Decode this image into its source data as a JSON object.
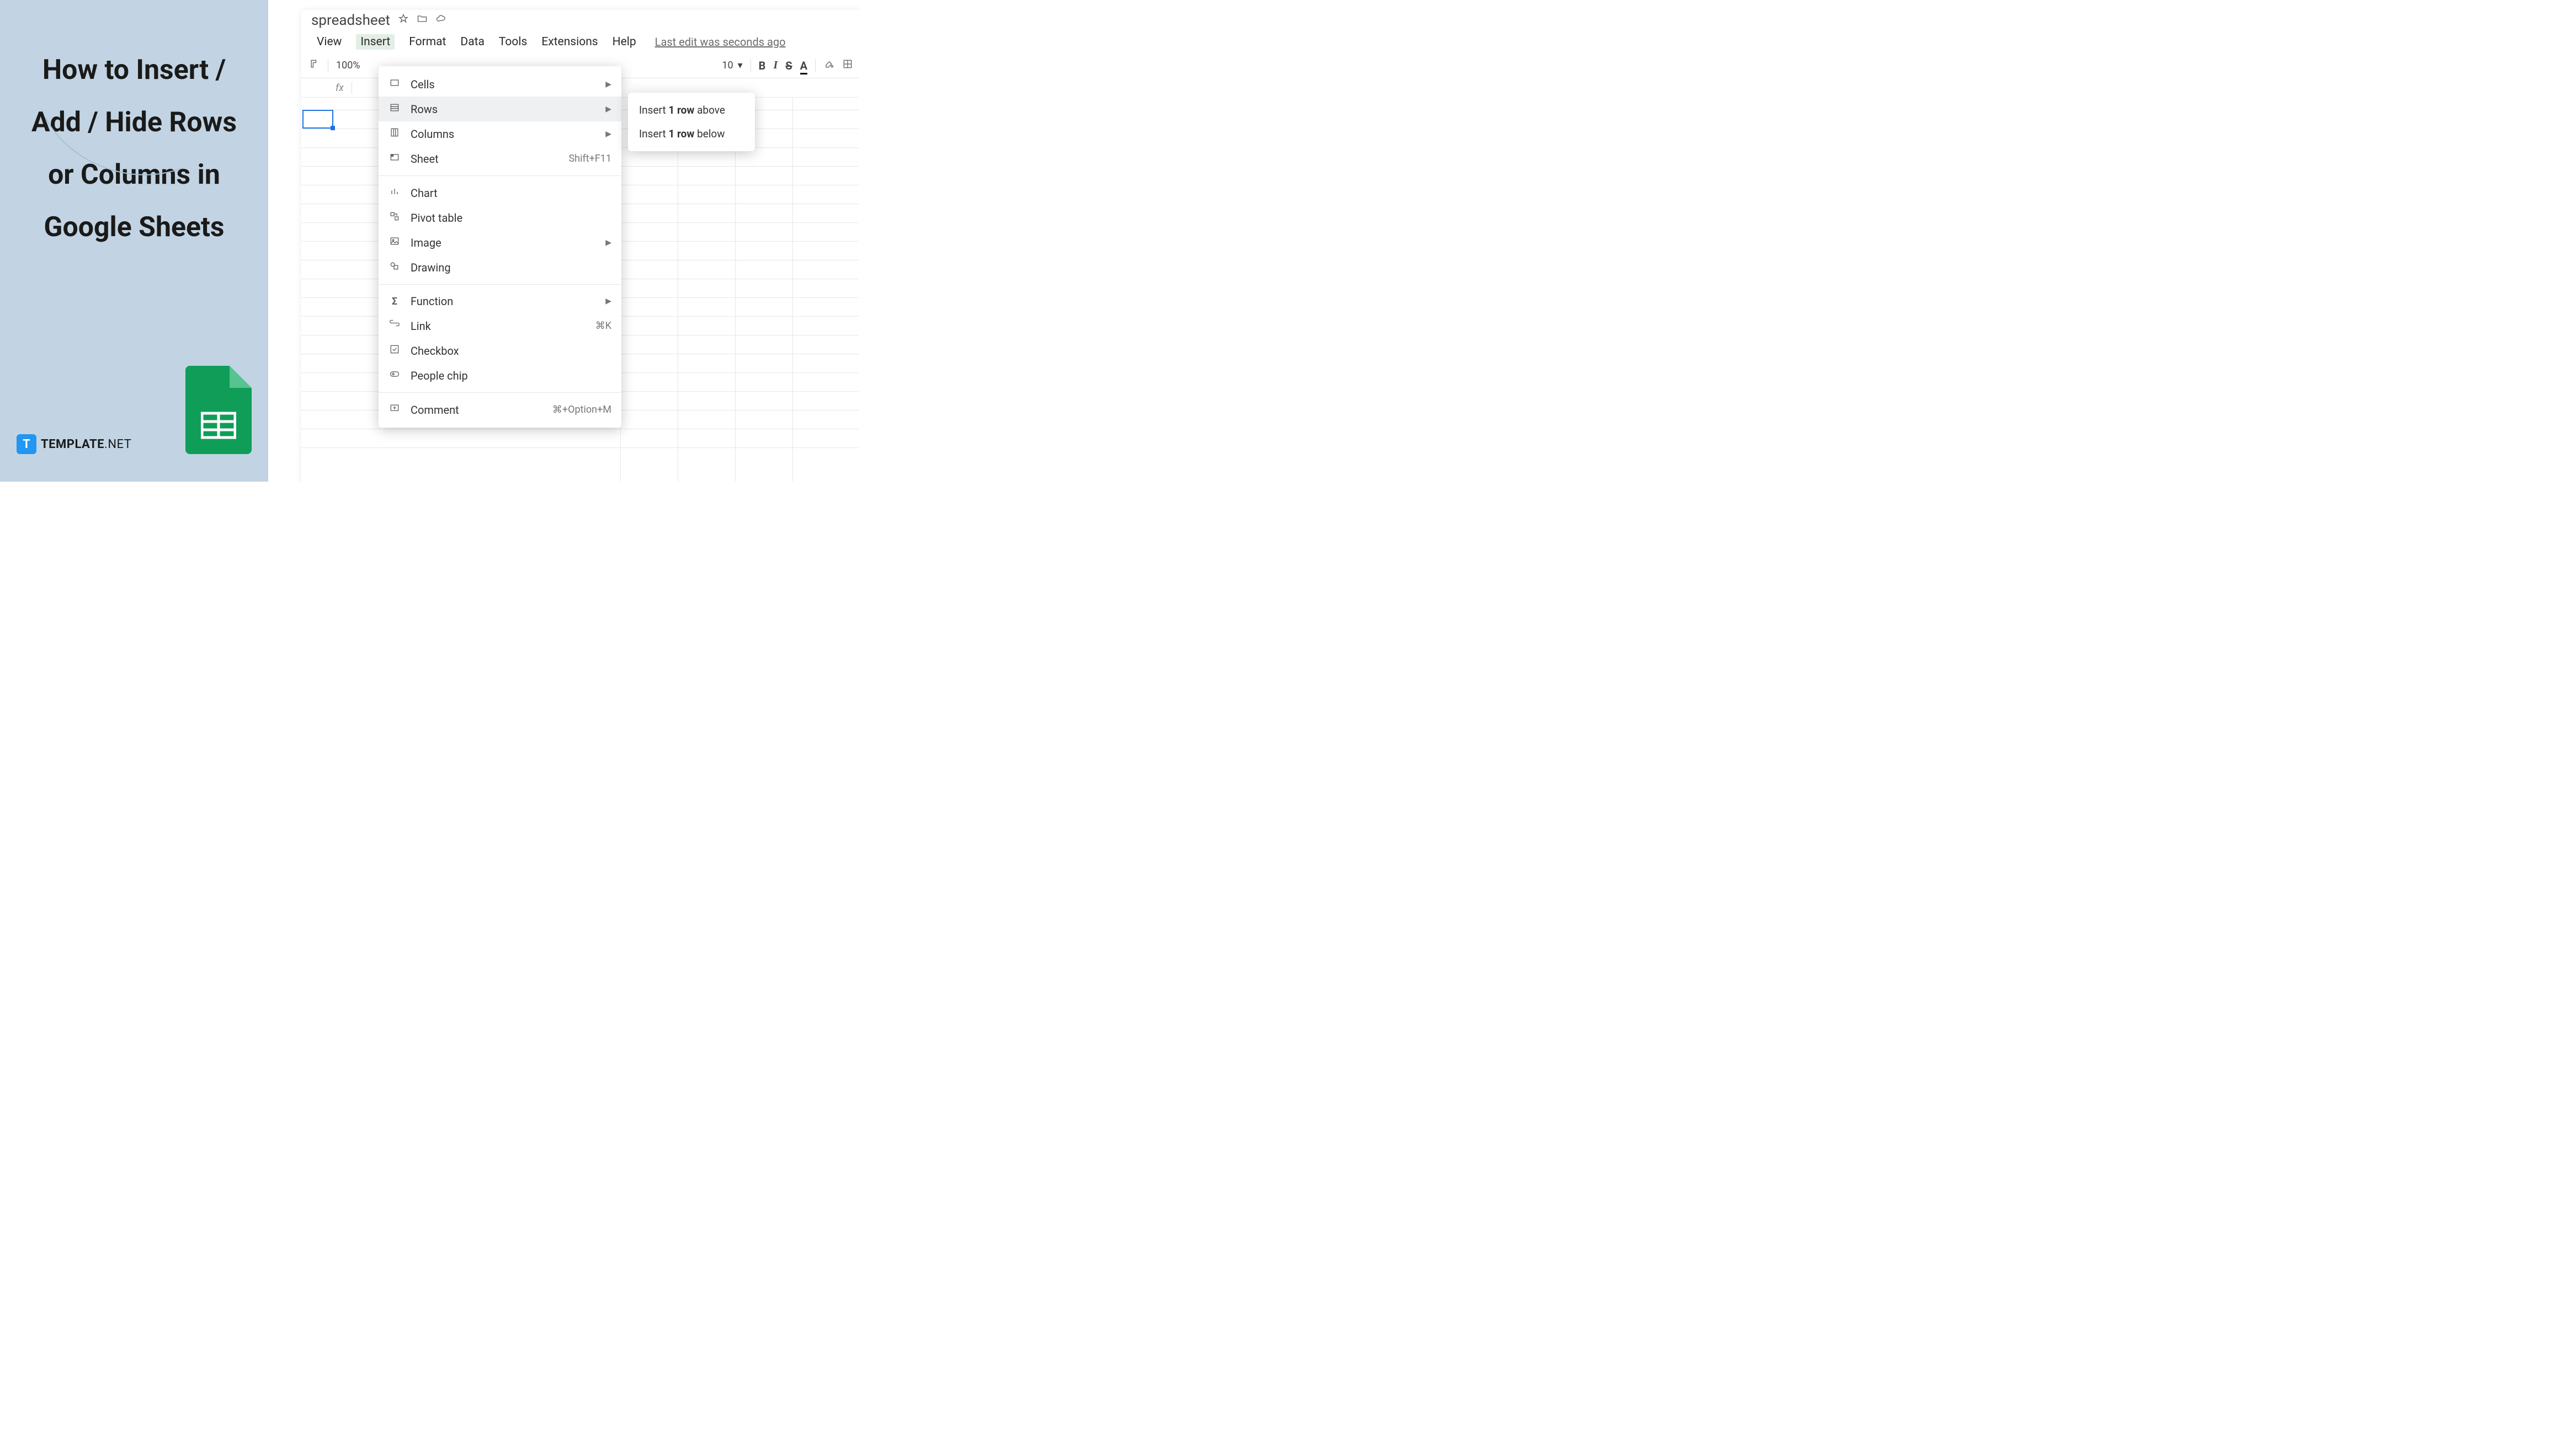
{
  "left": {
    "title": "How to Insert / Add / Hide Rows or Columns in Google Sheets",
    "brand_name": "TEMPLATE",
    "brand_suffix": ".NET"
  },
  "app": {
    "doc_title": "spreadsheet",
    "menu": {
      "view": "View",
      "insert": "Insert",
      "format": "Format",
      "data": "Data",
      "tools": "Tools",
      "extensions": "Extensions",
      "help": "Help"
    },
    "last_edit": "Last edit was seconds ago",
    "toolbar": {
      "zoom": "100%",
      "font_size": "10"
    }
  },
  "insert_menu": {
    "cells": "Cells",
    "rows": "Rows",
    "columns": "Columns",
    "sheet": "Sheet",
    "sheet_shortcut": "Shift+F11",
    "chart": "Chart",
    "pivot": "Pivot table",
    "image": "Image",
    "drawing": "Drawing",
    "function": "Function",
    "link": "Link",
    "link_shortcut": "⌘K",
    "checkbox": "Checkbox",
    "people": "People chip",
    "comment": "Comment",
    "comment_shortcut": "⌘+Option+M"
  },
  "rows_submenu": {
    "above_pre": "Insert ",
    "above_bold": "1 row",
    "above_post": " above",
    "below_pre": "Insert ",
    "below_bold": "1 row",
    "below_post": " below"
  }
}
